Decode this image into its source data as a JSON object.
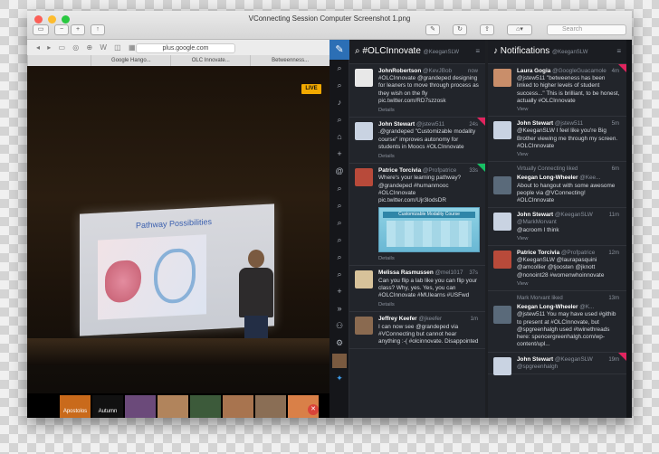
{
  "window": {
    "title": "VConnecting Session Computer Screenshot 1.png"
  },
  "toolbar": {
    "search_placeholder": "Search"
  },
  "browser": {
    "url": "plus.google.com",
    "tabs": [
      "Google Hango...",
      "OLC Innovate...",
      "Betweenness..."
    ],
    "live_badge": "LIVE",
    "slide_title": "Pathway Possibilities",
    "thumbs": [
      {
        "label": "Apostolos",
        "color": "#c96a1b"
      },
      {
        "label": "Autumn",
        "color": "#111111"
      },
      {
        "label": "",
        "color": "#6b4a7a"
      },
      {
        "label": "",
        "color": "#b1845c"
      },
      {
        "label": "",
        "color": "#3c5a3a"
      },
      {
        "label": "",
        "color": "#a8744f"
      },
      {
        "label": "",
        "color": "#8a6e55"
      },
      {
        "label": "",
        "color": "#d98048"
      }
    ]
  },
  "columns": [
    {
      "icon": "search-icon",
      "title": "#OLCInnovate",
      "account": "@KeeganSLW",
      "tweets": [
        {
          "name": "JohnRobertson",
          "handle": "@KevJBob",
          "time": "now",
          "text": "#OLCInnovate @grandeped designing for leaners to move through process as they wish on the fly pic.twitter.com/RD7szzosk",
          "media": "",
          "details": "Details",
          "ava": "#e8e8e8",
          "corner": ""
        },
        {
          "name": "John Stewart",
          "handle": "@jstew511",
          "time": "24s",
          "text": ".@grandeped \"Customizable modality course\" improves autonomy for students in Moocs #OLCInnovate",
          "media": "",
          "details": "Details",
          "ava": "#c9d3e2",
          "corner": "red"
        },
        {
          "name": "Patrice Torcivia",
          "handle": "@Profpatrice",
          "time": "33s",
          "text": "Where's your learning pathway? @grandeped #humanmooc #OLCInnovate pic.twitter.com/Ujr3lodsDR",
          "media": "Customizable Modality Course",
          "details": "Details",
          "ava": "#b84a3a",
          "corner": "green"
        },
        {
          "name": "Melissa Rasmussen",
          "handle": "@mel1017",
          "time": "37s",
          "text": "Can you flip a lab like you can flip your class? Why, yes. Yes, you can #OLCInnovate #MUlearns #USFwd",
          "media": "",
          "details": "Details",
          "ava": "#d7c29a",
          "corner": ""
        },
        {
          "name": "Jeffrey Keefer",
          "handle": "@jkeefer",
          "time": "1m",
          "text": "I can now see @grandeped via #VConnecting but cannot hear anything :-( #olcinnovate. Disappointed",
          "media": "",
          "details": "",
          "ava": "#8a6a50",
          "corner": ""
        }
      ]
    },
    {
      "icon": "bell-icon",
      "title": "Notifications",
      "account": "@KeeganSLW",
      "tweets": [
        {
          "name": "Laura Gogia",
          "handle": "@GoogleGuacamole",
          "time": "4m",
          "text": "@jstew511 \"betweeness has been linked to higher levels of student success...\" This is brilliant, to be honest, actually #OLCInnovate",
          "view": "View",
          "ava": "#c98e6a",
          "corner": "red",
          "action": ""
        },
        {
          "name": "John Stewart",
          "handle": "@jstew511",
          "time": "5m",
          "text": "@KeeganSLW I feel like you're Big Brother viewing me through my screen. #OLCInnovate",
          "view": "View",
          "ava": "#c9d3e2",
          "corner": "",
          "action": ""
        },
        {
          "name": "Keegan Long-Wheeler",
          "handle": "@Kee...",
          "time": "6m",
          "text": "About to hangout with some awesome people via @VConnecting! #OLCInnovate",
          "view": "",
          "ava": "#5a6a7a",
          "corner": "",
          "action": "Virtually Connecting liked"
        },
        {
          "name": "John Stewart",
          "handle": "@KeeganSLW @MarkMorvant",
          "time": "11m",
          "text": "@acroom I think",
          "view": "View",
          "ava": "#c9d3e2",
          "corner": "",
          "action": ""
        },
        {
          "name": "Patrice Torcivia",
          "handle": "@Profpatrice",
          "time": "12m",
          "text": "@KeeganSLW @laurapasquini @amcollier @tjoosten @jknott @nonoint28 #womenwhoinnovate",
          "view": "View",
          "ava": "#b84a3a",
          "corner": "",
          "action": ""
        },
        {
          "name": "Keegan Long-Wheeler",
          "handle": "@K...",
          "time": "13m",
          "text": "@jstew511 You may have used #githib to present at #OLCInnovate, but @spgreenhalgh used #twinethreads here: spencergreenhalgh.com/wp-content/upl...",
          "view": "",
          "ava": "#5a6a7a",
          "corner": "",
          "action": "Mark Morvant liked"
        },
        {
          "name": "John Stewart",
          "handle": "@KeeganSLW @spgreenhalgh",
          "time": "19m",
          "text": "",
          "view": "",
          "ava": "#c9d3e2",
          "corner": "red",
          "action": ""
        }
      ]
    }
  ],
  "colors": {
    "accent": "#2c6fb5",
    "live": "#f2a900",
    "background": "#1d1f23"
  }
}
